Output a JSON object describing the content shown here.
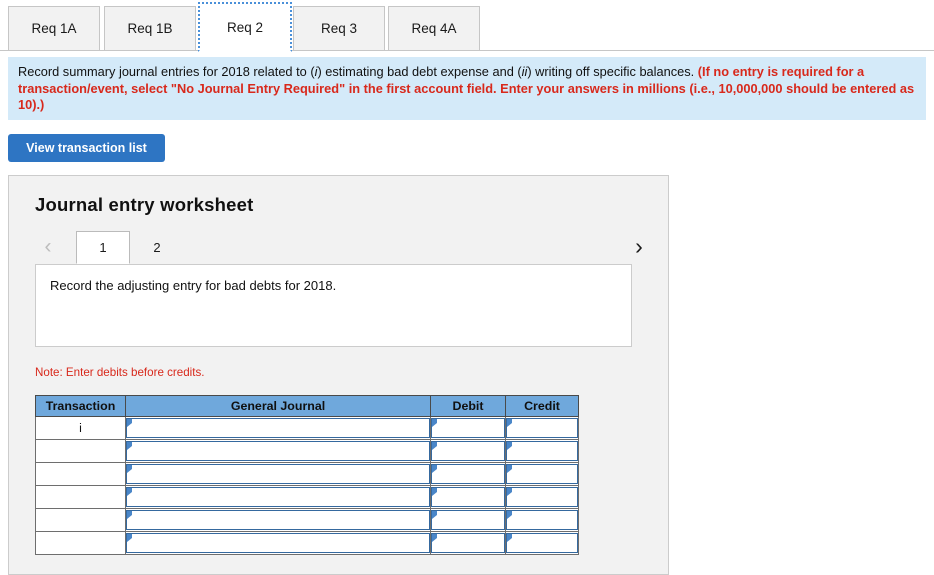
{
  "req_tabs": [
    {
      "label": "Req 1A",
      "active": false
    },
    {
      "label": "Req 1B",
      "active": false
    },
    {
      "label": "Req 2",
      "active": true
    },
    {
      "label": "Req 3",
      "active": false
    },
    {
      "label": "Req 4A",
      "active": false
    }
  ],
  "instruction": {
    "black_part_1": "Record summary journal entries for 2018 related to (",
    "italic_1": "i",
    "black_part_2": ") estimating bad debt expense and (",
    "italic_2": "ii",
    "black_part_3": ") writing off specific balances. ",
    "red_part": "(If no entry is required for a transaction/event, select \"No Journal Entry Required\" in the first account field. Enter your answers in millions (i.e., 10,000,000 should be entered as 10).)"
  },
  "toolbar": {
    "view_transaction_list_label": "View transaction list"
  },
  "worksheet": {
    "title": "Journal entry worksheet",
    "pager": {
      "prev_icon": "chevron-left",
      "prev_glyph": "‹",
      "next_icon": "chevron-right",
      "next_glyph": "›",
      "pages": [
        {
          "label": "1",
          "active": true
        },
        {
          "label": "2",
          "active": false
        }
      ]
    },
    "task_description": "Record the adjusting entry for bad debts for 2018.",
    "note": "Note: Enter debits before credits.",
    "table": {
      "headers": [
        "Transaction",
        "General Journal",
        "Debit",
        "Credit"
      ],
      "rows": [
        {
          "transaction": "i",
          "general_journal": "",
          "debit": "",
          "credit": ""
        },
        {
          "transaction": "",
          "general_journal": "",
          "debit": "",
          "credit": ""
        },
        {
          "transaction": "",
          "general_journal": "",
          "debit": "",
          "credit": ""
        },
        {
          "transaction": "",
          "general_journal": "",
          "debit": "",
          "credit": ""
        },
        {
          "transaction": "",
          "general_journal": "",
          "debit": "",
          "credit": ""
        },
        {
          "transaction": "",
          "general_journal": "",
          "debit": "",
          "credit": ""
        }
      ]
    }
  },
  "colors": {
    "banner_bg": "#d4eaf9",
    "button_blue": "#2e75c3",
    "table_header_blue": "#6fa8dc",
    "red_text": "#d8291c",
    "input_border_blue": "#35699f",
    "panel_bg": "#f2f2f2"
  }
}
